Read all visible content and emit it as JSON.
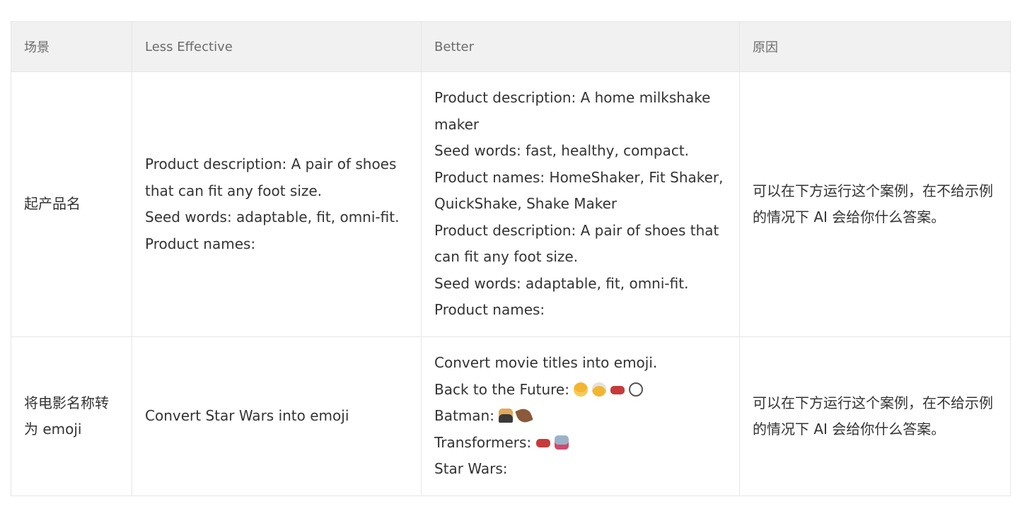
{
  "table": {
    "headers": [
      "场景",
      "Less Effective",
      "Better",
      "原因"
    ],
    "rows": [
      {
        "scenario": "起产品名",
        "less_effective": [
          "Product description: A pair of shoes that can fit any foot size.",
          "Seed words: adaptable, fit, omni-fit.",
          "Product names:"
        ],
        "better": [
          "Product description: A home milkshake maker",
          "Seed words: fast, healthy, compact.",
          "Product names: HomeShaker, Fit Shaker, QuickShake, Shake Maker",
          "Product description: A pair of shoes that can fit any foot size.",
          "Seed words: adaptable, fit, omni-fit.",
          "Product names:"
        ],
        "reason": "可以在下方运行这个案例，在不给示例的情况下 AI 会给你什么答案。"
      },
      {
        "scenario": "将电影名称转为 emoji",
        "less_effective": [
          "Convert Star Wars into emoji"
        ],
        "better": {
          "line1": "Convert movie titles into emoji.",
          "line2": {
            "label": "Back to the Future:",
            "emoji": [
              "person-blond-hair-icon",
              "older-man-icon",
              "car-icon",
              "clock-icon"
            ]
          },
          "line3": {
            "label": "Batman:",
            "emoji": [
              "man-in-suit-icon",
              "bat-icon"
            ]
          },
          "line4": {
            "label": "Transformers:",
            "emoji": [
              "car-icon",
              "robot-icon"
            ]
          },
          "line5": "Star Wars:"
        },
        "reason": "可以在下方运行这个案例，在不给示例的情况下 AI 会给你什么答案。"
      }
    ]
  }
}
